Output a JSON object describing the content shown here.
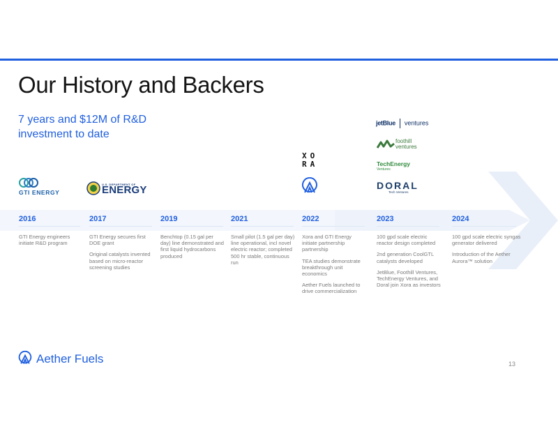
{
  "header": {
    "title": "Our History and Backers",
    "subtitle_line1": "7 years and $12M of R&D",
    "subtitle_line2": "investment to date"
  },
  "logos": {
    "gti": "GTI ENERGY",
    "doe_small": "U.S. DEPARTMENT OF",
    "doe_big": "ENERGY",
    "xora": "XO\nRA",
    "jetblue": "jetBlue",
    "jetblue_ventures": "ventures",
    "foothill_line1": "foothill",
    "foothill_line2": "ventures",
    "techenergy": "TechEnergy",
    "techenergy_sub": "Ventures",
    "doral": "DORAL",
    "doral_sub": "Tech Ventures"
  },
  "timeline": [
    {
      "year": "2016",
      "items": [
        "GTI Energy engineers initiate R&D program"
      ]
    },
    {
      "year": "2017",
      "items": [
        "GTI Energy secures first DOE grant",
        "Original catalysts invented based on micro-reactor screening studies"
      ]
    },
    {
      "year": "2019",
      "items": [
        "Benchtop (0.15 gal per day) line demonstrated and first liquid hydrocarbons produced"
      ]
    },
    {
      "year": "2021",
      "items": [
        "Small pilot (1.5 gal per day) line operational, incl novel electric reactor; completed 500 hr stable, continuous run"
      ]
    },
    {
      "year": "2022",
      "items": [
        "Xora and GTI Energy initiate partnership partnership",
        "TEA studies demonstrate breakthrough unit economics",
        "Aether Fuels launched to drive commercialization"
      ]
    },
    {
      "year": "2023",
      "items": [
        "100 gpd scale electric reactor design completed",
        "2nd generation CoolGTL catalysts developed",
        "JetBlue, Foothill Ventures, TechEnergy Ventures, and Doral join Xora as investors"
      ]
    },
    {
      "year": "2024",
      "items": [
        "100 gpd scale electric syngas generator delivered",
        "Introduction of the Aether Aurora™ solution"
      ]
    }
  ],
  "footer": {
    "brand": "Aether Fuels",
    "page_number": "13"
  },
  "colors": {
    "accent": "#1f5fe0",
    "arrow": "#eef3fb"
  }
}
